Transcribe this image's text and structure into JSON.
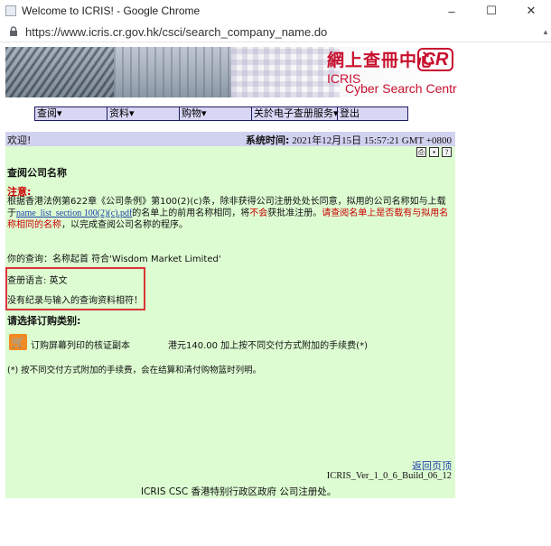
{
  "browser": {
    "window_title": "Welcome to ICRIS! - Google Chrome",
    "url": "https://www.icris.cr.gov.hk/csci/search_company_name.do",
    "minimize": "–",
    "maximize": "☐",
    "close": "✕"
  },
  "banner": {
    "cn_title": "網上查冊中心",
    "logo": "CR",
    "icris": "ICRIS",
    "en_title": "Cyber Search Centre"
  },
  "menu": {
    "items": [
      {
        "label": "查阅▾"
      },
      {
        "label": "资料▾"
      },
      {
        "label": "购物▾"
      },
      {
        "label": "关於电子查册服务▾"
      },
      {
        "label": "登出"
      }
    ]
  },
  "header": {
    "welcome": "欢迎!",
    "systime_label": "系统时间:",
    "systime_value": "2021年12月15日 15:57:21 GMT +0800"
  },
  "tools": {
    "print": "⎙",
    "save": "▪",
    "help": "?"
  },
  "page": {
    "title": "查阅公司名称",
    "notice_label": "注意:",
    "notice_part1": "根据香港法例第622章《公司条例》第100(2)(c)条，除非获得公司注册处处长同意，拟用的公司名称如与上载于",
    "notice_link": "name_list_section 100(2)(c).pdf",
    "notice_part2": "的名单上的前用名称相同，将",
    "notice_red1": "不会",
    "notice_part3": "获批准注册。",
    "notice_red2": "请查阅名单上是否载有与拟用名称相同的名称",
    "notice_part4": "，以完成查阅公司名称的程序。",
    "query": "你的查询：名称起首 符合'Wisdom Market Limited'",
    "language": "查册语言: 英文",
    "no_record": "没有纪录与输入的查询资料相符！",
    "order_title": "请选择订购类别:",
    "order_item": "订购屏幕列印的核证副本",
    "order_price": "港元140.00 加上按不同交付方式附加的手续费(*)",
    "footnote": "(*) 按不同交付方式附加的手续费，会在结算和清付购物篮时列明。",
    "back_to_top": "返回页顶",
    "version": "ICRIS_Ver_1_0_6_Build_06_12",
    "footer": "ICRIS CSC 香港特别行政区政府 公司注册处。"
  }
}
